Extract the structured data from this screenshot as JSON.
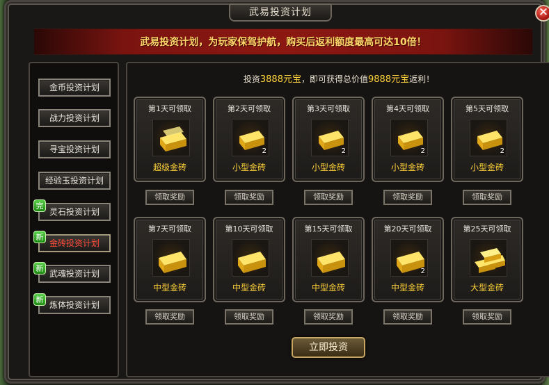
{
  "window": {
    "title": "武易投资计划",
    "close_label": "✕"
  },
  "banner": {
    "text": "武易投资计划，为玩家保驾护航，购买后返利额度最高可达10倍！"
  },
  "sidebar": {
    "items": [
      {
        "label": "金币投资计划",
        "tag": ""
      },
      {
        "label": "战力投资计划",
        "tag": ""
      },
      {
        "label": "寻宝投资计划",
        "tag": ""
      },
      {
        "label": "经验玉投资计划",
        "tag": ""
      },
      {
        "label": "灵石投资计划",
        "tag": "完"
      },
      {
        "label": "金砖投资计划",
        "tag": "新"
      },
      {
        "label": "武魂投资计划",
        "tag": "新"
      },
      {
        "label": "炼体投资计划",
        "tag": "新"
      }
    ]
  },
  "invest": {
    "prefix": "投资",
    "amount": "3888元宝",
    "middle": "，即可获得总价值",
    "total": "9888元宝",
    "suffix": "返利！"
  },
  "rewards": [
    {
      "day": "第1天可领取",
      "name": "超级金砖",
      "count": "",
      "icon": "gold-bar-icon"
    },
    {
      "day": "第2天可领取",
      "name": "小型金砖",
      "count": "2",
      "icon": "gold-bar-icon"
    },
    {
      "day": "第3天可领取",
      "name": "小型金砖",
      "count": "2",
      "icon": "gold-bar-icon"
    },
    {
      "day": "第4天可领取",
      "name": "小型金砖",
      "count": "2",
      "icon": "gold-bar-icon"
    },
    {
      "day": "第5天可领取",
      "name": "小型金砖",
      "count": "2",
      "icon": "gold-bar-icon"
    },
    {
      "day": "第7天可领取",
      "name": "中型金砖",
      "count": "",
      "icon": "gold-bar-icon"
    },
    {
      "day": "第10天可领取",
      "name": "中型金砖",
      "count": "",
      "icon": "gold-bar-icon"
    },
    {
      "day": "第15天可领取",
      "name": "中型金砖",
      "count": "",
      "icon": "gold-bar-icon"
    },
    {
      "day": "第20天可领取",
      "name": "中型金砖",
      "count": "2",
      "icon": "gold-bar-icon"
    },
    {
      "day": "第25天可领取",
      "name": "大型金砖",
      "count": "",
      "icon": "gold-bar-stack-icon"
    }
  ],
  "claim_label": "领取奖励",
  "invest_button": "立即投资",
  "colors": {
    "gold_text": "#ffd23a",
    "active_red": "#ff4a3a",
    "banner_red": "#8c1812",
    "tag_green": "#2aa81a"
  }
}
